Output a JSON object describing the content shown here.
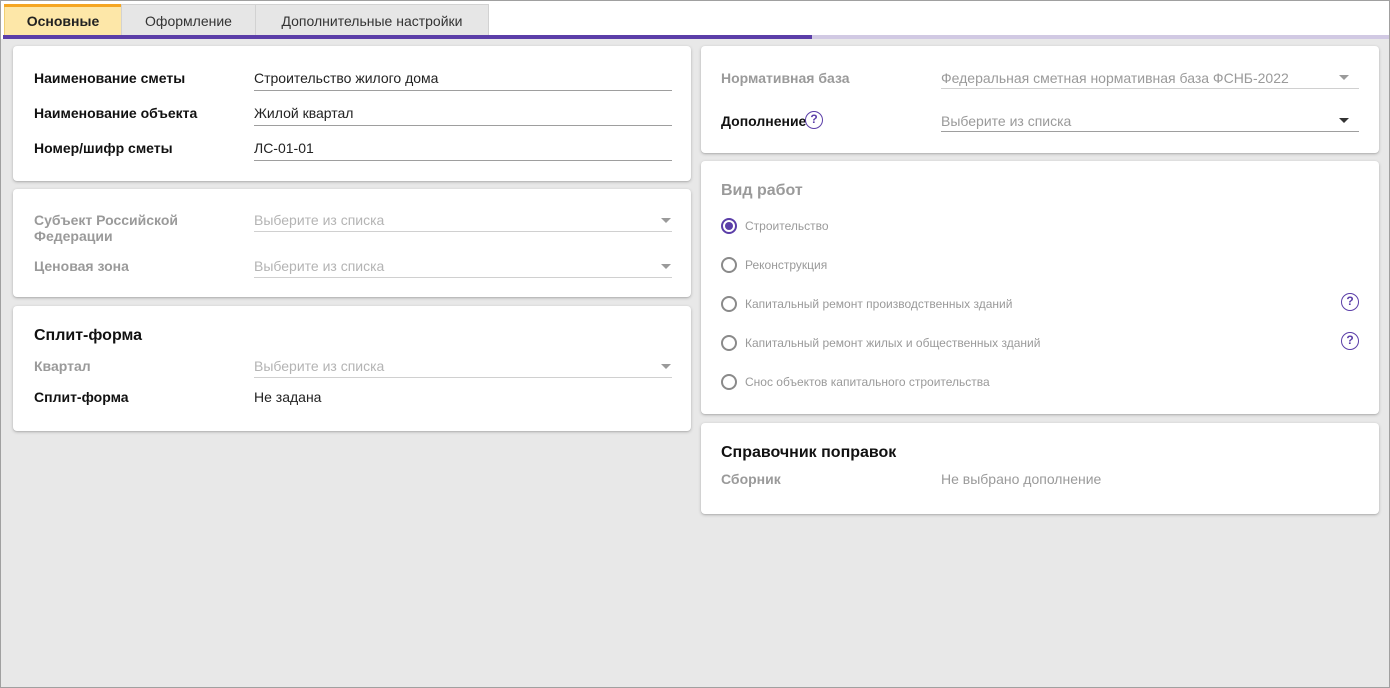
{
  "tabs": [
    {
      "label": "Основные",
      "active": true
    },
    {
      "label": "Оформление",
      "active": false
    },
    {
      "label": "Дополнительные настройки",
      "active": false
    }
  ],
  "estimate": {
    "name_label": "Наименование сметы",
    "name_value": "Строительство жилого дома",
    "object_label": "Наименование объекта",
    "object_value": "Жилой квартал",
    "code_label": "Номер/шифр сметы",
    "code_value": "ЛС-01-01"
  },
  "region": {
    "subject_label": "Субъект Российской Федерации",
    "subject_placeholder": "Выберите из списка",
    "zone_label": "Ценовая зона",
    "zone_placeholder": "Выберите из списка"
  },
  "split": {
    "title": "Сплит-форма",
    "quarter_label": "Квартал",
    "quarter_placeholder": "Выберите из списка",
    "form_label": "Сплит-форма",
    "form_value": "Не задана"
  },
  "normative": {
    "base_label": "Нормативная база",
    "base_value": "Федеральная сметная нормативная база ФСНБ-2022",
    "addition_label": "Дополнение",
    "addition_placeholder": "Выберите из списка",
    "help_glyph": "?"
  },
  "work_type": {
    "title": "Вид работ",
    "selected_index": 0,
    "options": [
      {
        "label": "Строительство",
        "help": false
      },
      {
        "label": "Реконструкция",
        "help": false
      },
      {
        "label": "Капитальный ремонт производственных зданий",
        "help": true
      },
      {
        "label": "Капитальный ремонт жилых и общественных зданий",
        "help": true
      },
      {
        "label": "Снос объектов капитального строительства",
        "help": false
      }
    ]
  },
  "corrections": {
    "title": "Справочник поправок",
    "collection_label": "Сборник",
    "collection_value": "Не выбрано дополнение"
  },
  "colors": {
    "accent": "#5b3ea8",
    "tab_active_bg": "#fde7a8",
    "tab_active_top": "#f5a623",
    "page_bg": "#e8e8e8"
  },
  "icons": {
    "help": "help-circle-icon",
    "dropdown": "chevron-down-icon",
    "radio": "radio-button"
  }
}
